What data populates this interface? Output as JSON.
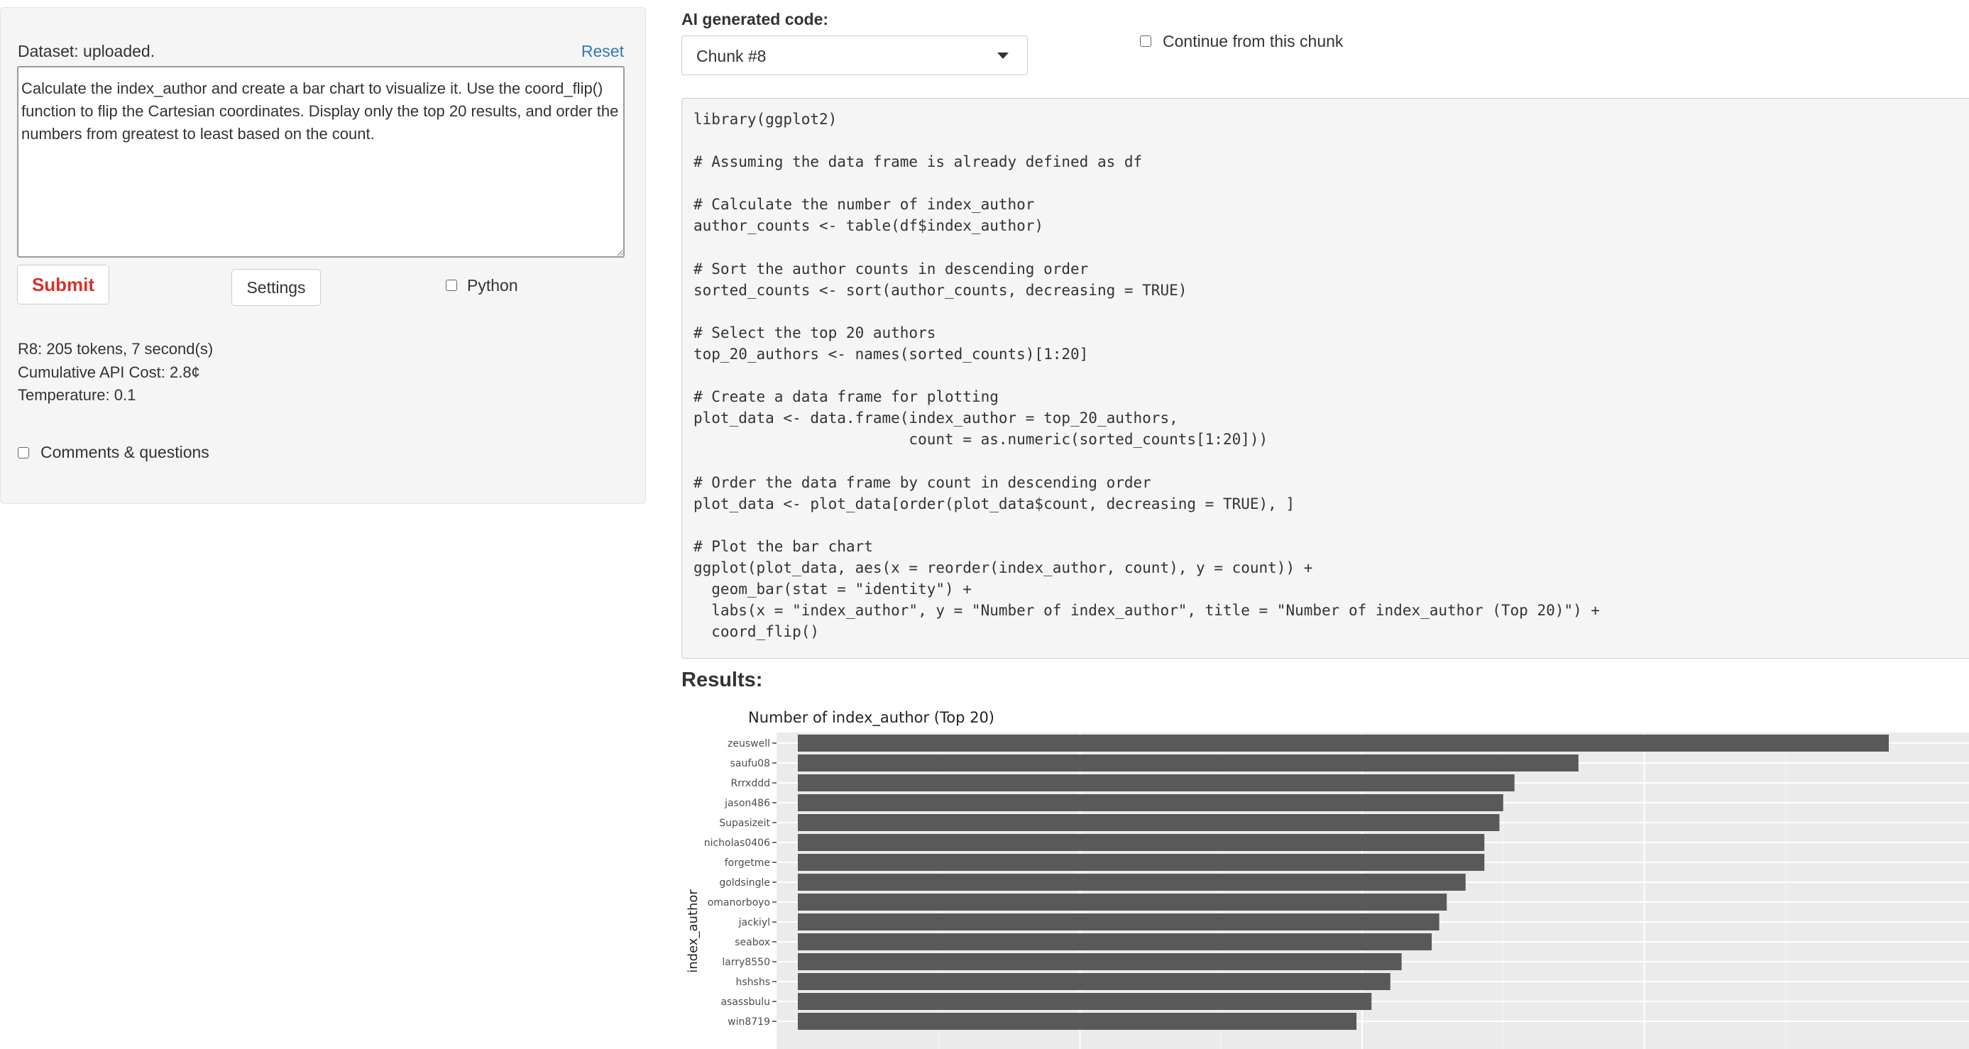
{
  "left_panel": {
    "dataset_status": "Dataset: uploaded.",
    "reset_label": "Reset",
    "prompt_text": "Calculate the index_author and create a bar chart to visualize it. Use the coord_flip() function to flip the Cartesian coordinates. Display only the top 20 results, and order the numbers from greatest to least based on the count.",
    "submit_label": "Submit",
    "settings_label": "Settings",
    "python_label": "Python",
    "python_checked": false,
    "stats": {
      "tokens_line": "R8: 205 tokens, 7 second(s)",
      "cost_line": "Cumulative API Cost: 2.8¢",
      "temperature_line": "Temperature: 0.1"
    },
    "comments_label": "Comments & questions",
    "comments_checked": false
  },
  "code_panel": {
    "title": "AI generated code:",
    "chunk_selected": "Chunk #8",
    "continue_label": "Continue from this chunk",
    "continue_checked": false,
    "code_lines": [
      "library(ggplot2)",
      "",
      "# Assuming the data frame is already defined as df",
      "",
      "# Calculate the number of index_author",
      "author_counts <- table(df$index_author)",
      "",
      "# Sort the author counts in descending order",
      "sorted_counts <- sort(author_counts, decreasing = TRUE)",
      "",
      "# Select the top 20 authors",
      "top_20_authors <- names(sorted_counts)[1:20]",
      "",
      "# Create a data frame for plotting",
      "plot_data <- data.frame(index_author = top_20_authors,",
      "                        count = as.numeric(sorted_counts[1:20]))",
      "",
      "# Order the data frame by count in descending order",
      "plot_data <- plot_data[order(plot_data$count, decreasing = TRUE), ]",
      "",
      "# Plot the bar chart",
      "ggplot(plot_data, aes(x = reorder(index_author, count), y = count)) +",
      "  geom_bar(stat = \"identity\") +",
      "  labs(x = \"index_author\", y = \"Number of index_author\", title = \"Number of index_author (Top 20)\") +",
      "  coord_flip()"
    ]
  },
  "results": {
    "title": "Results:"
  },
  "chart_data": {
    "type": "bar",
    "orientation": "horizontal",
    "title": "Number of index_author (Top 20)",
    "xlabel": "index_author",
    "ylabel": "",
    "categories": [
      "zeuswell",
      "saufu08",
      "Rrrxddd",
      "jason486",
      "Supasizeit",
      "nicholas0406",
      "forgetme",
      "goldsingle",
      "omanorboyo",
      "jackiyl",
      "seabox",
      "larry8550",
      "hshshs",
      "asassbulu",
      "win8719"
    ],
    "values": [
      58,
      41.5,
      38.1,
      37.5,
      37.3,
      36.5,
      36.5,
      35.5,
      34.5,
      34.1,
      33.7,
      32.1,
      31.5,
      30.5,
      29.7
    ],
    "xlim": [
      0,
      60
    ],
    "colors": {
      "bar": "#595959",
      "panel": "#ebebeb",
      "grid": "#ffffff"
    }
  }
}
